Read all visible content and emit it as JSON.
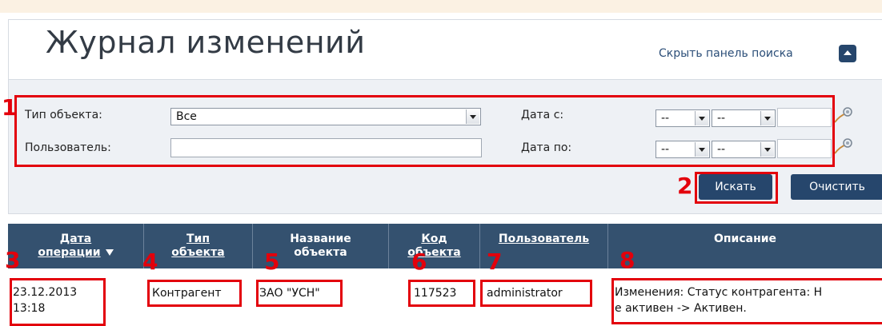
{
  "page": {
    "title": "Журнал изменений",
    "hide_search_label": "Скрыть панель поиска"
  },
  "filters": {
    "object_type_label": "Тип объекта:",
    "object_type_value": "Все",
    "user_label": "Пользователь:",
    "user_value": "",
    "date_from_label": "Дата с:",
    "date_to_label": "Дата по:",
    "date_from_day": "--",
    "date_from_month": "--",
    "date_to_day": "--",
    "date_to_month": "--"
  },
  "buttons": {
    "search": "Искать",
    "clear": "Очистить"
  },
  "table": {
    "columns": [
      {
        "line1": "Дата",
        "line2": "операции"
      },
      {
        "line1": "Тип",
        "line2": "объекта"
      },
      {
        "line1": "Название",
        "line2": "объекта"
      },
      {
        "line1": "Код",
        "line2": "объекта"
      },
      {
        "line1": "Пользователь",
        "line2": ""
      },
      {
        "line1": "Описание",
        "line2": ""
      }
    ],
    "rows": [
      {
        "date": "23.12.2013",
        "time": "13:18",
        "type": "Контрагент",
        "name": "ЗАО \"УСН\"",
        "code": "117523",
        "user": "administrator",
        "desc1": "Изменения: Статус контрагента: Н",
        "desc2": "е активен -> Активен."
      }
    ]
  },
  "annotations": [
    "1",
    "2",
    "3",
    "4",
    "5",
    "6",
    "7",
    "8"
  ],
  "colors": {
    "accent": "#26466c",
    "header_bg": "#34516f",
    "annotation": "#e3000b",
    "panel_bg": "#eef1f5"
  }
}
